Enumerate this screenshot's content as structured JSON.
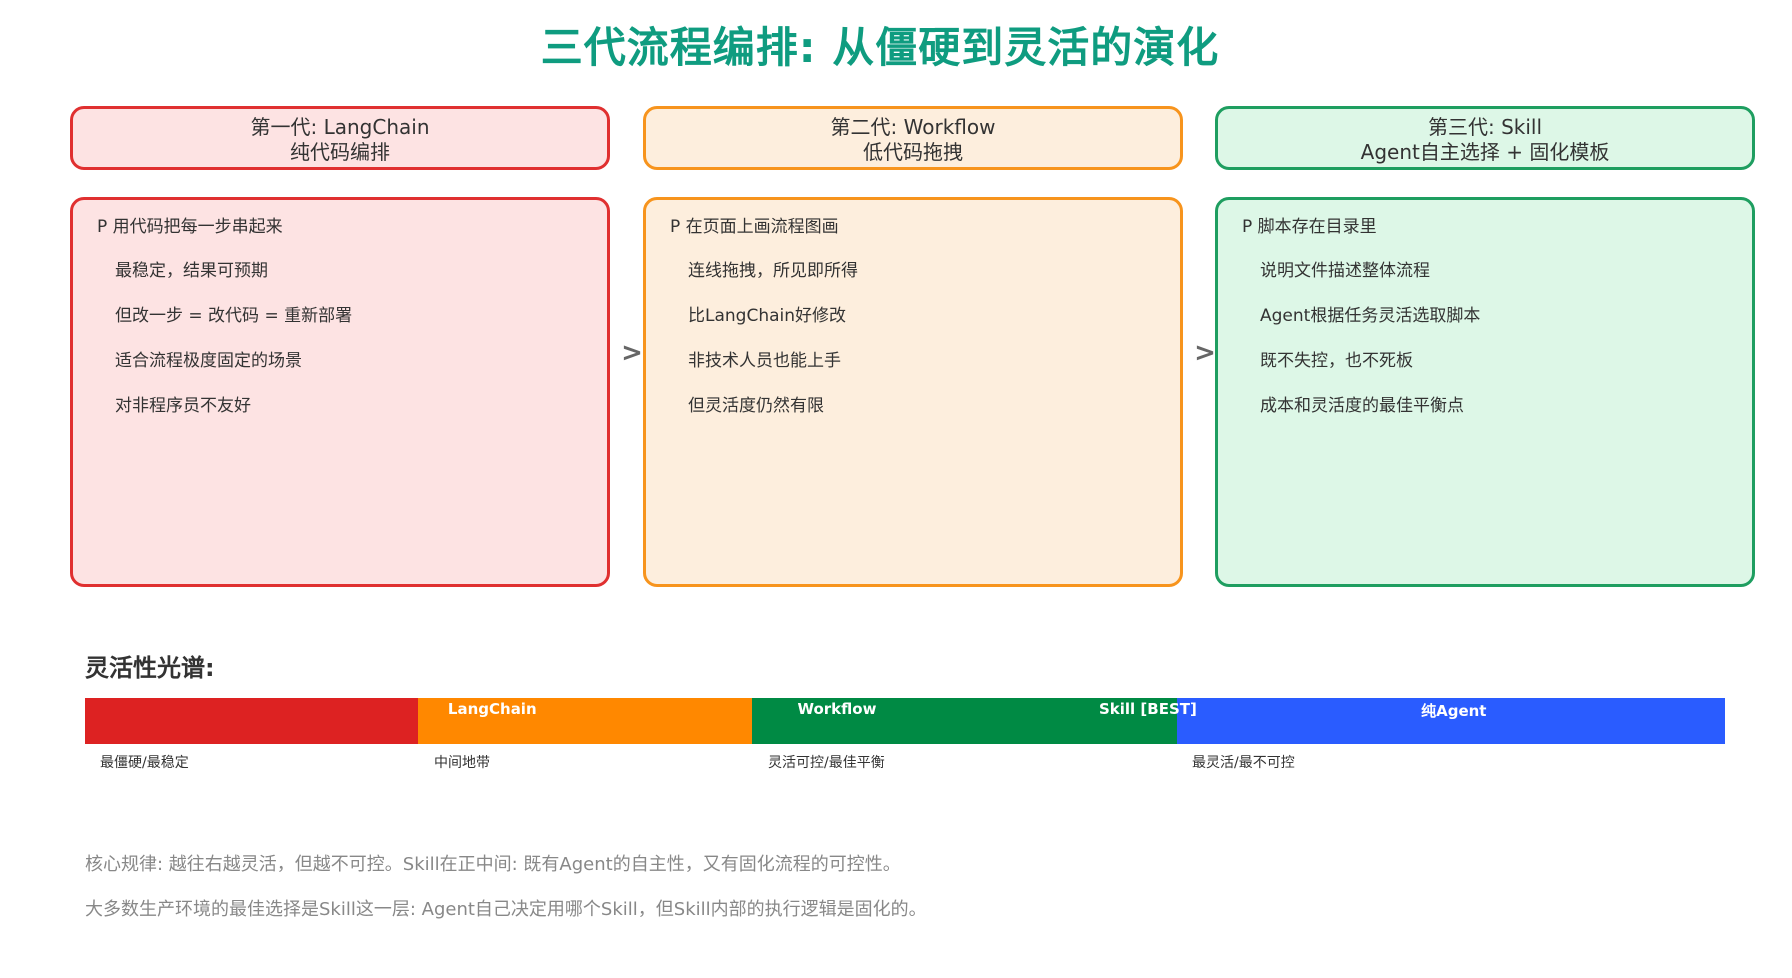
{
  "title": "三代流程编排: 从僵硬到灵活的演化",
  "generations": [
    {
      "name": "第一代: LangChain",
      "subtitle": "纯代码编排",
      "lead": "P 用代码把每一步串起来",
      "points": [
        "最稳定，结果可预期",
        "但改一步 = 改代码 = 重新部署",
        "适合流程极度固定的场景",
        "对非程序员不友好"
      ],
      "border_color": "#e03030",
      "fill_color": "#fde3e3"
    },
    {
      "name": "第二代: Workflow",
      "subtitle": "低代码拖拽",
      "lead": "P 在页面上画流程图画",
      "points": [
        "连线拖拽，所见即所得",
        "比LangChain好修改",
        "非技术人员也能上手",
        "但灵活度仍然有限"
      ],
      "border_color": "#f7941d",
      "fill_color": "#fdeedd"
    },
    {
      "name": "第三代: Skill",
      "subtitle": "Agent自主选择 + 固化模板",
      "lead": "P 脚本存在目录里",
      "points": [
        "说明文件描述整体流程",
        "Agent根据任务灵活选取脚本",
        "既不失控，也不死板",
        "成本和灵活度的最佳平衡点"
      ],
      "border_color": "#1e9e60",
      "fill_color": "#ddf7e7"
    }
  ],
  "arrow_glyph": ">",
  "spectrum": {
    "title": "灵活性光谱:",
    "segments": [
      {
        "label": "",
        "color": "#dd2222",
        "start": 0.0,
        "end": 0.203
      },
      {
        "label": "LangChain",
        "color": "#ff8800",
        "start": 0.203,
        "end": 0.407
      },
      {
        "label": "Workflow",
        "color": "#008a44",
        "start": 0.407,
        "end": 0.666
      },
      {
        "label": "纯Agent",
        "color": "#2a5cff",
        "start": 0.666,
        "end": 1.0
      }
    ],
    "skill_label": "Skill [BEST]",
    "tick_labels": [
      "最僵硬/最稳定",
      "中间地带",
      "灵活可控/最佳平衡",
      "最灵活/最不可控"
    ]
  },
  "notes": [
    "核心规律: 越往右越灵活，但越不可控。Skill在正中间: 既有Agent的自主性，又有固化流程的可控性。",
    "大多数生产环境的最佳选择是Skill这一层: Agent自己决定用哪个Skill，但Skill内部的执行逻辑是固化的。"
  ]
}
